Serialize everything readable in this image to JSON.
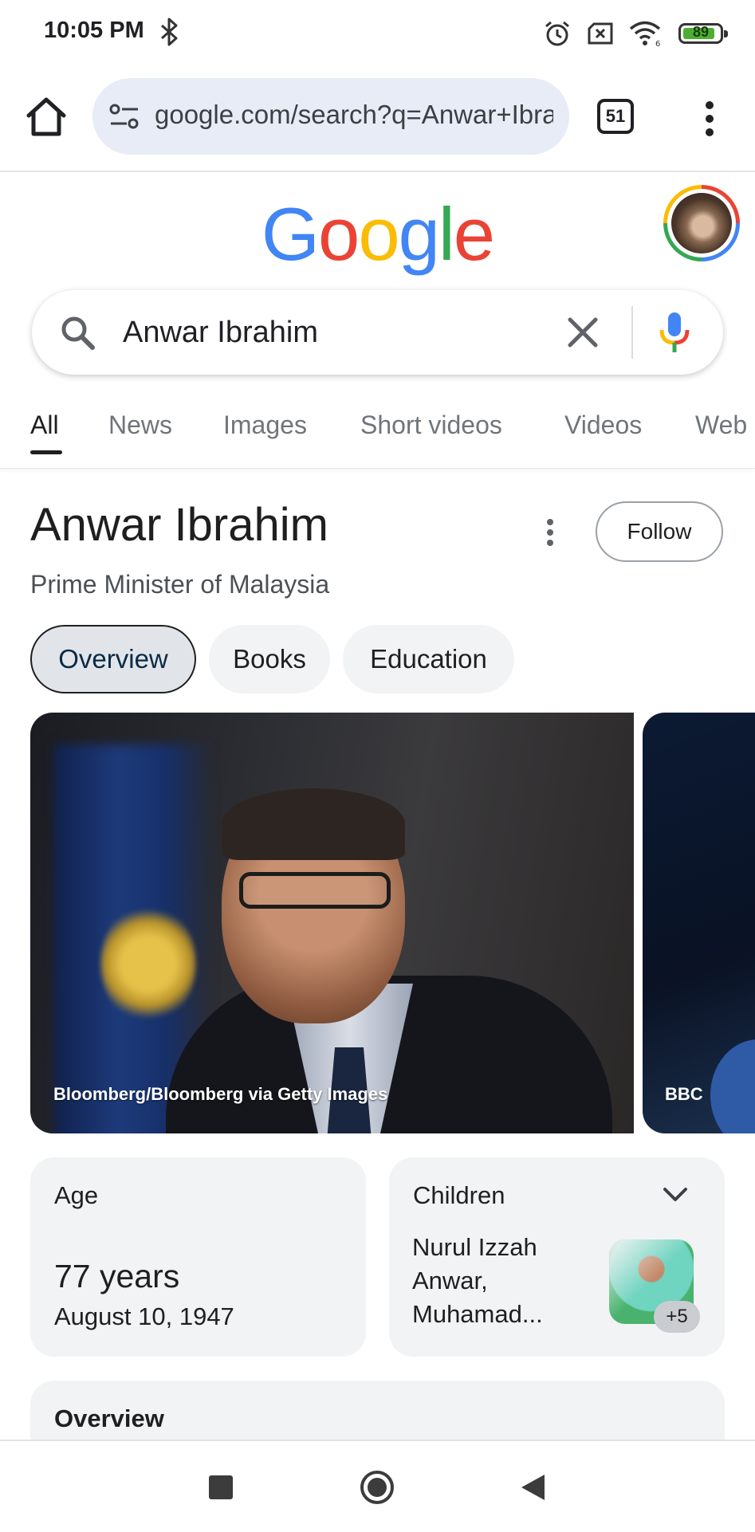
{
  "status_bar": {
    "time": "10:05 PM",
    "battery_level": 89,
    "battery_label": "89",
    "icons": [
      "bluetooth-icon",
      "alarm-icon",
      "no-sim-icon",
      "wifi-icon",
      "battery-icon"
    ]
  },
  "browser": {
    "url": "google.com/search?q=Anwar+Ibrahim",
    "tab_count": "51"
  },
  "search": {
    "query": "Anwar Ibrahim",
    "logo_letters": [
      "G",
      "o",
      "o",
      "g",
      "l",
      "e"
    ],
    "logo_colors": [
      "#4285f4",
      "#ea4335",
      "#fbbc05",
      "#4285f4",
      "#34a853",
      "#ea4335"
    ]
  },
  "filter_tabs": [
    {
      "label": "All",
      "active": true
    },
    {
      "label": "News",
      "active": false
    },
    {
      "label": "Images",
      "active": false
    },
    {
      "label": "Short videos",
      "active": false
    },
    {
      "label": "Videos",
      "active": false
    },
    {
      "label": "Web",
      "active": false
    }
  ],
  "knowledge_panel": {
    "title": "Anwar Ibrahim",
    "subtitle": "Prime Minister of Malaysia",
    "follow_label": "Follow",
    "chips": [
      {
        "label": "Overview",
        "active": true
      },
      {
        "label": "Books",
        "active": false
      },
      {
        "label": "Education",
        "active": false
      }
    ],
    "photos": [
      {
        "caption": "Bloomberg/Bloomberg via Getty Images"
      },
      {
        "caption": "BBC"
      }
    ],
    "age_card": {
      "label": "Age",
      "value": "77 years",
      "date": "August 10, 1947"
    },
    "children_card": {
      "label": "Children",
      "names": "Nurul Izzah Anwar, Muhamad...",
      "more_count": "+5"
    },
    "overview_label": "Overview"
  },
  "colors": {
    "accent_blue": "#4285f4",
    "chip_bg": "#f1f3f4",
    "omnibox_bg": "#e8ecf7"
  }
}
